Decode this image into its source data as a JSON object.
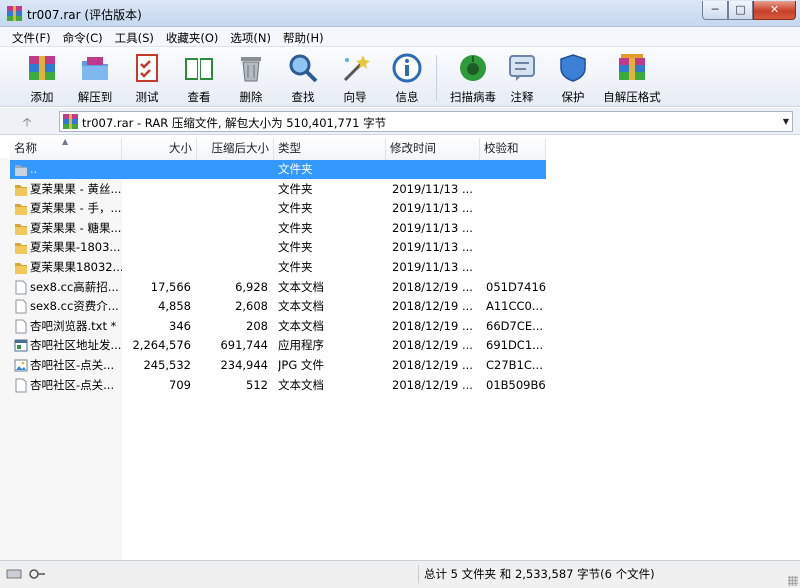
{
  "window": {
    "title": "tr007.rar (评估版本)",
    "min": "─",
    "max": "□",
    "close": "✕"
  },
  "menu": [
    "文件(F)",
    "命令(C)",
    "工具(S)",
    "收藏夹(O)",
    "选项(N)",
    "帮助(H)"
  ],
  "toolbar": [
    {
      "label": "添加",
      "icon": "add-archive-icon"
    },
    {
      "label": "解压到",
      "icon": "extract-to-icon"
    },
    {
      "label": "测试",
      "icon": "test-icon"
    },
    {
      "label": "查看",
      "icon": "view-icon"
    },
    {
      "label": "删除",
      "icon": "delete-icon"
    },
    {
      "label": "查找",
      "icon": "find-icon"
    },
    {
      "label": "向导",
      "icon": "wizard-icon"
    },
    {
      "label": "信息",
      "icon": "info-icon"
    },
    {
      "label": "扫描病毒",
      "icon": "virus-scan-icon"
    },
    {
      "label": "注释",
      "icon": "comment-icon"
    },
    {
      "label": "保护",
      "icon": "protect-icon"
    },
    {
      "label": "自解压格式",
      "icon": "sfx-icon"
    }
  ],
  "address": {
    "text": "tr007.rar - RAR 压缩文件, 解包大小为 510,401,771 字节",
    "up": "🡡"
  },
  "columns": {
    "name": "名称",
    "size": "大小",
    "packed": "压缩后大小",
    "type": "类型",
    "modified": "修改时间",
    "crc": "校验和"
  },
  "files": [
    {
      "name": "..",
      "size": "",
      "packed": "",
      "type": "文件夹",
      "modified": "",
      "crc": "",
      "icon": "folder-up",
      "selected": true
    },
    {
      "name": "夏茉果果 - 黄丝...",
      "size": "",
      "packed": "",
      "type": "文件夹",
      "modified": "2019/11/13 ...",
      "crc": "",
      "icon": "folder"
    },
    {
      "name": "夏茉果果 - 手，...",
      "size": "",
      "packed": "",
      "type": "文件夹",
      "modified": "2019/11/13 ...",
      "crc": "",
      "icon": "folder"
    },
    {
      "name": "夏茉果果 - 糖果...",
      "size": "",
      "packed": "",
      "type": "文件夹",
      "modified": "2019/11/13 ...",
      "crc": "",
      "icon": "folder"
    },
    {
      "name": "夏茉果果-1803...",
      "size": "",
      "packed": "",
      "type": "文件夹",
      "modified": "2019/11/13 ...",
      "crc": "",
      "icon": "folder"
    },
    {
      "name": "夏茉果果18032...",
      "size": "",
      "packed": "",
      "type": "文件夹",
      "modified": "2019/11/13 ...",
      "crc": "",
      "icon": "folder"
    },
    {
      "name": "sex8.cc高薪招...",
      "size": "17,566",
      "packed": "6,928",
      "type": "文本文档",
      "modified": "2018/12/19 ...",
      "crc": "051D7416",
      "icon": "text"
    },
    {
      "name": "sex8.cc资费介...",
      "size": "4,858",
      "packed": "2,608",
      "type": "文本文档",
      "modified": "2018/12/19 ...",
      "crc": "A11CC0...",
      "icon": "text"
    },
    {
      "name": "杏吧浏览器.txt *",
      "size": "346",
      "packed": "208",
      "type": "文本文档",
      "modified": "2018/12/19 ...",
      "crc": "66D7CE...",
      "icon": "text"
    },
    {
      "name": "杏吧社区地址发...",
      "size": "2,264,576",
      "packed": "691,744",
      "type": "应用程序",
      "modified": "2018/12/19 ...",
      "crc": "691DC1...",
      "icon": "exe"
    },
    {
      "name": "杏吧社区-点关...",
      "size": "245,532",
      "packed": "234,944",
      "type": "JPG 文件",
      "modified": "2018/12/19 ...",
      "crc": "C27B1C...",
      "icon": "image"
    },
    {
      "name": "杏吧社区-点关...",
      "size": "709",
      "packed": "512",
      "type": "文本文档",
      "modified": "2018/12/19 ...",
      "crc": "01B509B6",
      "icon": "text"
    }
  ],
  "status": {
    "text": "总计 5 文件夹 和 2,533,587 字节(6 个文件)"
  }
}
